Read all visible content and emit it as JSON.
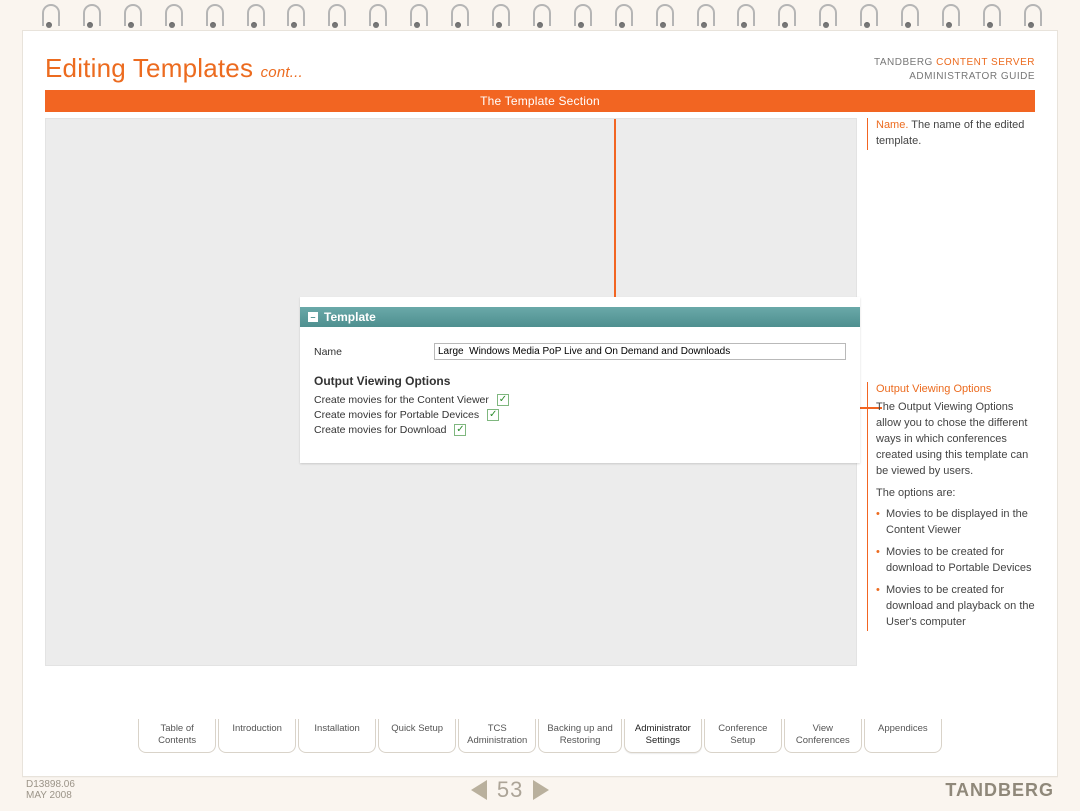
{
  "header": {
    "title": "Editing Templates",
    "title_suffix": "cont...",
    "doc_brand_a": "TANDBERG",
    "doc_brand_b": "CONTENT SERVER",
    "doc_sub": "ADMINISTRATOR GUIDE"
  },
  "section_bar": "The Template Section",
  "screenshot": {
    "panel_title": "Template",
    "name_label": "Name",
    "name_value": "Large  Windows Media PoP Live and On Demand and Downloads",
    "subheading": "Output Viewing Options",
    "checks": [
      {
        "label": "Create movies for the Content Viewer",
        "checked": true
      },
      {
        "label": "Create movies for Portable Devices",
        "checked": true
      },
      {
        "label": "Create movies for Download",
        "checked": true
      }
    ]
  },
  "side": {
    "name_head": "Name.",
    "name_body": " The name of the edited template.",
    "ovo_head": "Output Viewing Options",
    "ovo_p1": "The Output Viewing Options allow you to chose the different ways in which conferences created using this template can be viewed by users.",
    "ovo_p2": "The options are:",
    "ovo_items": [
      "Movies to be displayed in the Content Viewer",
      "Movies to be created for download to Portable Devices",
      "Movies to be created for download and playback on the User's computer"
    ]
  },
  "tabs": [
    "Table of\nContents",
    "Introduction",
    "Installation",
    "Quick Setup",
    "TCS\nAdministration",
    "Backing up and\nRestoring",
    "Administrator\nSettings",
    "Conference\nSetup",
    "View\nConferences",
    "Appendices"
  ],
  "active_tab_index": 6,
  "footer": {
    "doc_code": "D13898.06",
    "doc_date": "MAY 2008",
    "page": "53",
    "brand": "TANDBERG"
  }
}
